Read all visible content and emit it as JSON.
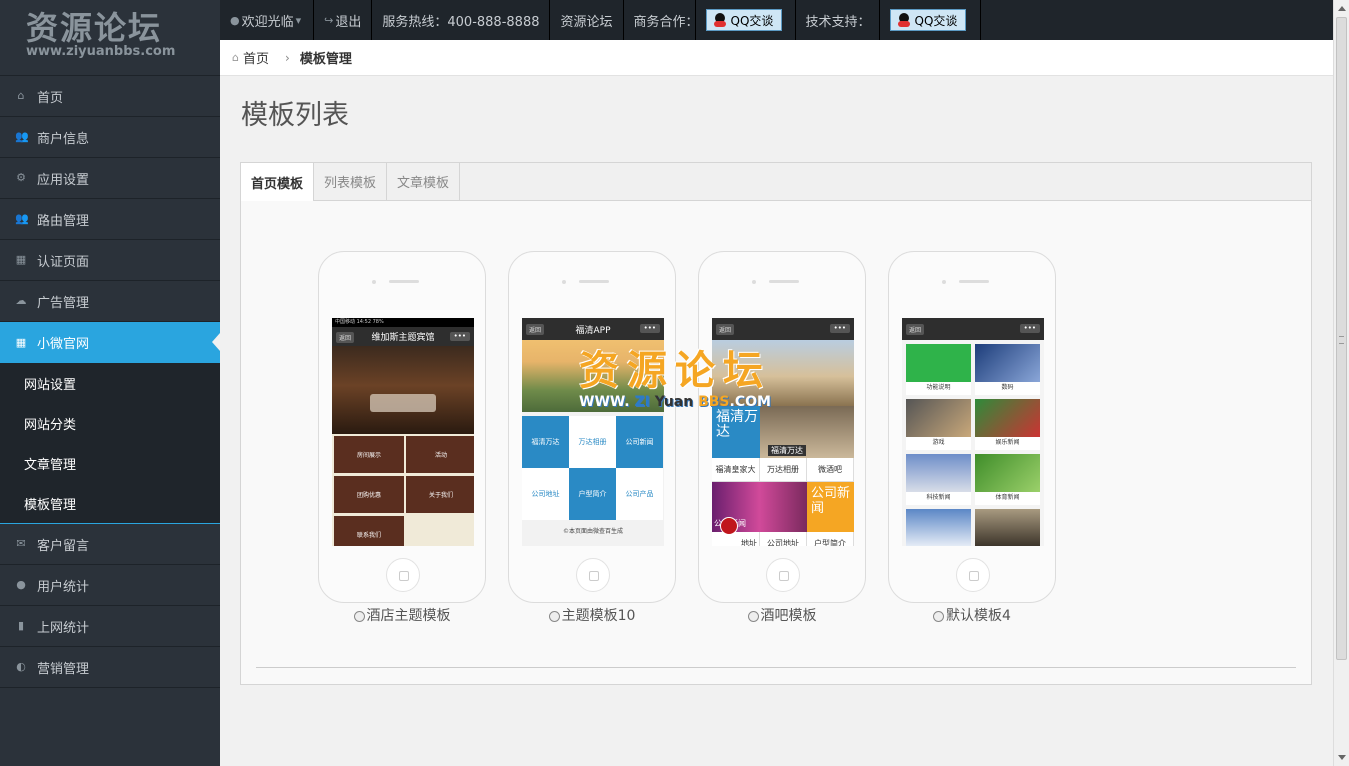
{
  "logo": {
    "title": "资源论坛",
    "subtitle": "www.ziyuanbbs.com"
  },
  "sidebar": {
    "items": [
      {
        "label": "首页",
        "icon": "home-icon"
      },
      {
        "label": "商户信息",
        "icon": "users-icon"
      },
      {
        "label": "应用设置",
        "icon": "gears-icon"
      },
      {
        "label": "路由管理",
        "icon": "users-icon"
      },
      {
        "label": "认证页面",
        "icon": "table-icon"
      },
      {
        "label": "广告管理",
        "icon": "cloud-icon"
      },
      {
        "label": "小微官网",
        "icon": "grid-icon"
      },
      {
        "label": "客户留言",
        "icon": "envelope-icon"
      },
      {
        "label": "用户统计",
        "icon": "user-icon"
      },
      {
        "label": "上网统计",
        "icon": "bar-chart-icon"
      },
      {
        "label": "营销管理",
        "icon": "dashboard-icon"
      }
    ],
    "submenu": [
      {
        "label": "网站设置"
      },
      {
        "label": "网站分类"
      },
      {
        "label": "文章管理"
      },
      {
        "label": "模板管理"
      }
    ]
  },
  "topbar": {
    "welcome": "欢迎光临",
    "logout": "退出",
    "hotline": "服务热线：400-888-8888",
    "forum": "资源论坛",
    "business": "商务合作：",
    "qq_label": "QQ交谈",
    "tech_support": "技术支持：",
    "qq_label_2": "QQ交谈"
  },
  "breadcrumb": {
    "home": "首页",
    "current": "模板管理"
  },
  "page": {
    "title": "模板列表"
  },
  "tabs": [
    {
      "label": "首页模板",
      "active": true
    },
    {
      "label": "列表模板",
      "active": false
    },
    {
      "label": "文章模板",
      "active": false
    }
  ],
  "templates": [
    {
      "name": "酒店主题模板",
      "screen": {
        "status": "中国移动 14:52 78%",
        "header": "维加斯主题宾馆",
        "cells": [
          "房间展示",
          "活动",
          "团购优惠",
          "关于我们",
          "联系我们"
        ]
      }
    },
    {
      "name": "主题模板10",
      "screen": {
        "header": "福清APP",
        "cells": [
          "福清万达",
          "万达相册",
          "公司新闻",
          "公司地址",
          "户型简介",
          "公司产品"
        ],
        "footer": "©本页面由微查百生成"
      }
    },
    {
      "name": "酒吧模板",
      "screen": {
        "big_left": "福清万达",
        "tag": "福清万达",
        "row1": [
          "福清皇家大",
          "万达相册",
          "微酒吧"
        ],
        "big_right": "公司新闻",
        "overlay": "公司新闻",
        "row2": [
          "地址",
          "公司地址",
          "户型简介"
        ]
      }
    },
    {
      "name": "默认模板4",
      "screen": {
        "cells": [
          "功能说明",
          "数码",
          "游戏",
          "娱乐新闻",
          "科技新闻",
          "体育新闻"
        ]
      }
    }
  ],
  "screen_common": {
    "back": "返回",
    "more": "•••"
  },
  "watermark": {
    "line1": "资源论坛",
    "www": "WWW.",
    "zi": "ZI",
    "yuan": "Yuan",
    "bbs": "BBS",
    "com": ".COM"
  },
  "colors": {
    "accent": "#2aa5df",
    "sidebar_bg": "#2b323a",
    "topbar_bg": "#1f252b",
    "hotel_brown": "#5a2e1f",
    "tile_blue": "#2a8ac5",
    "orange": "#f5a623"
  }
}
